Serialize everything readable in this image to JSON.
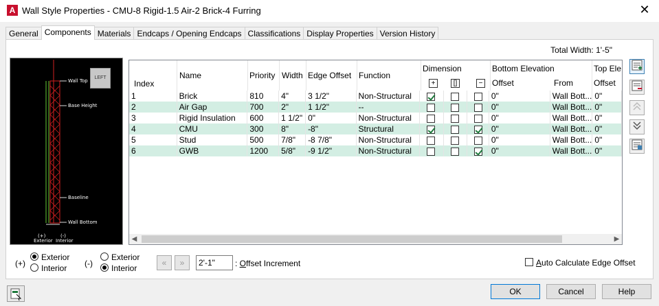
{
  "window": {
    "title": "Wall Style Properties - CMU-8 Rigid-1.5 Air-2 Brick-4 Furring",
    "app_icon": "A",
    "close": "✕"
  },
  "tabs": [
    {
      "label": "General"
    },
    {
      "label": "Components",
      "active": true
    },
    {
      "label": "Materials"
    },
    {
      "label": "Endcaps / Opening Endcaps"
    },
    {
      "label": "Classifications"
    },
    {
      "label": "Display Properties"
    },
    {
      "label": "Version History"
    }
  ],
  "total_width": "Total Width: 1'-5\"",
  "preview": {
    "left_button": "LEFT",
    "labels": {
      "wall_top": "Wall Top",
      "base_height": "Base Height",
      "baseline": "Baseline",
      "wall_bottom": "Wall Bottom",
      "exterior_sign": "(+)",
      "exterior": "Exterior",
      "interior_sign": "(-)",
      "interior": "Interior"
    }
  },
  "grid": {
    "headers": {
      "index": "Index",
      "name": "Name",
      "priority": "Priority",
      "width": "Width",
      "edge_offset": "Edge Offset",
      "function": "Function",
      "dimension": "Dimension",
      "bottom_elevation": "Bottom Elevation",
      "offset": "Offset",
      "from": "From",
      "top_elevation": "Top Ele",
      "top_offset": "Offset"
    },
    "dimension_icons": [
      "+",
      "[]",
      "−"
    ],
    "rows": [
      {
        "index": "1",
        "name": "Brick",
        "priority": "810",
        "width": "4\"",
        "edge_offset": "3 1/2\"",
        "function": "Non-Structural",
        "dim1": true,
        "dim2": false,
        "dim3": false,
        "bottom_offset": "0\"",
        "from": "Wall Bott...",
        "top_offset": "0\""
      },
      {
        "index": "2",
        "name": "Air Gap",
        "priority": "700",
        "width": "2\"",
        "edge_offset": "1 1/2\"",
        "function": "--",
        "dim1": false,
        "dim2": false,
        "dim3": false,
        "bottom_offset": "0\"",
        "from": "Wall Bott...",
        "top_offset": "0\""
      },
      {
        "index": "3",
        "name": "Rigid Insulation",
        "priority": "600",
        "width": "1 1/2\"",
        "edge_offset": "0\"",
        "function": "Non-Structural",
        "dim1": false,
        "dim2": false,
        "dim3": false,
        "bottom_offset": "0\"",
        "from": "Wall Bott...",
        "top_offset": "0\""
      },
      {
        "index": "4",
        "name": "CMU",
        "priority": "300",
        "width": "8\"",
        "edge_offset": "-8\"",
        "function": "Structural",
        "dim1": true,
        "dim2": false,
        "dim3": true,
        "bottom_offset": "0\"",
        "from": "Wall Bott...",
        "top_offset": "0\""
      },
      {
        "index": "5",
        "name": "Stud",
        "priority": "500",
        "width": "7/8\"",
        "edge_offset": "-8 7/8\"",
        "function": "Non-Structural",
        "dim1": false,
        "dim2": false,
        "dim3": false,
        "bottom_offset": "0\"",
        "from": "Wall Bott...",
        "top_offset": "0\""
      },
      {
        "index": "6",
        "name": "GWB",
        "priority": "1200",
        "width": "5/8\"",
        "edge_offset": "-9 1/2\"",
        "function": "Non-Structural",
        "dim1": false,
        "dim2": false,
        "dim3": true,
        "bottom_offset": "0\"",
        "from": "Wall Bott...",
        "top_offset": "0\""
      }
    ]
  },
  "side_buttons": [
    "add-component-icon",
    "remove-component-icon",
    "move-up-icon",
    "move-down-icon",
    "component-settings-icon"
  ],
  "exterior_group": {
    "sign": "(+)",
    "options": [
      "Exterior",
      "Interior"
    ],
    "selected": "Exterior"
  },
  "interior_group": {
    "sign": "(-)",
    "options": [
      "Exterior",
      "Interior"
    ],
    "selected": "Interior"
  },
  "offset_increment": {
    "value": "2'-1\"",
    "label_prefix": ": ",
    "label_underlined": "O",
    "label_rest": "ffset Increment"
  },
  "auto_calc": {
    "underlined": "A",
    "rest": "uto Calculate Edge Offset",
    "checked": false
  },
  "buttons": {
    "ok": "OK",
    "cancel": "Cancel",
    "help": "Help"
  },
  "colors": {
    "alt_row": "#d3eee3",
    "check_green": "#1e7a3c",
    "accent": "#0078d7"
  }
}
